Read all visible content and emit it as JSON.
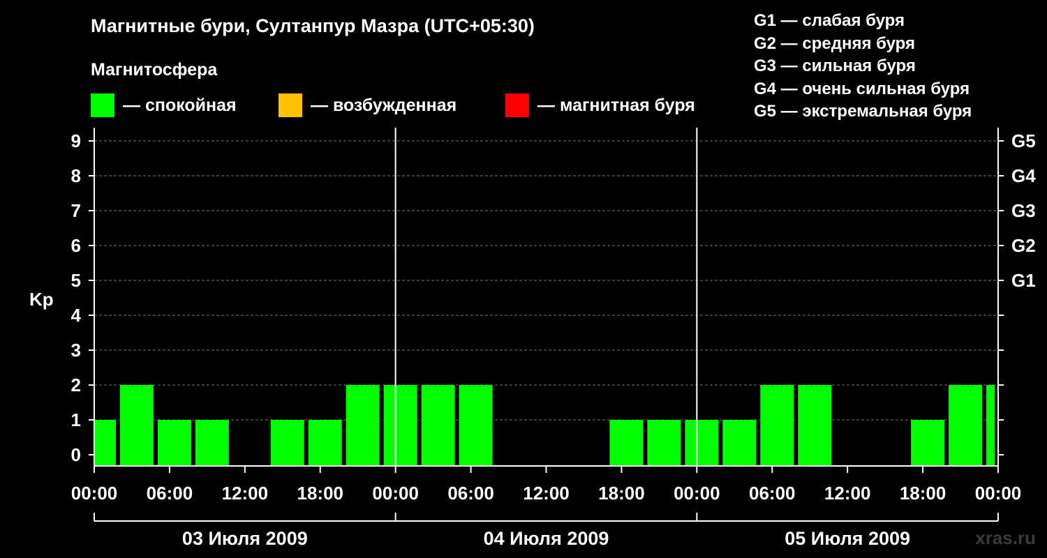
{
  "title": "Магнитные бури, Султанпур Мазра (UTC+05:30)",
  "subtitle": "Магнитосфера",
  "legend": [
    {
      "label": "— спокойная",
      "color": "#00ff00"
    },
    {
      "label": "— возбужденная",
      "color": "#ffc000"
    },
    {
      "label": "— магнитная буря",
      "color": "#ff0000"
    }
  ],
  "g_scale": [
    "G1 — слабая буря",
    "G2 — средняя буря",
    "G3 — сильная буря",
    "G4 — очень сильная буря",
    "G5 — экстремальная буря"
  ],
  "watermark": "xras.ru",
  "chart_data": {
    "type": "bar",
    "ylabel": "Kp",
    "ylim": [
      0,
      9
    ],
    "yticks": [
      "0",
      "1",
      "2",
      "3",
      "4",
      "5",
      "6",
      "7",
      "8",
      "9"
    ],
    "y2ticks": [
      {
        "value": 5,
        "label": "G1"
      },
      {
        "value": 6,
        "label": "G2"
      },
      {
        "value": 7,
        "label": "G3"
      },
      {
        "value": 8,
        "label": "G4"
      },
      {
        "value": 9,
        "label": "G5"
      }
    ],
    "xticks": [
      "00:00",
      "06:00",
      "12:00",
      "18:00",
      "00:00",
      "06:00",
      "12:00",
      "18:00",
      "00:00",
      "06:00",
      "12:00",
      "18:00",
      "00:00"
    ],
    "days": [
      "03 Июля 2009",
      "04 Июля 2009",
      "05 Июля 2009"
    ],
    "grid": true,
    "series": [
      {
        "values": [
          {
            "start": "2009-07-03 00:00",
            "end": "2009-07-03 02:00",
            "kp": 1,
            "status": "спокойная"
          },
          {
            "start": "2009-07-03 02:00",
            "end": "2009-07-03 05:00",
            "kp": 2,
            "status": "спокойная"
          },
          {
            "start": "2009-07-03 05:00",
            "end": "2009-07-03 08:00",
            "kp": 1,
            "status": "спокойная"
          },
          {
            "start": "2009-07-03 08:00",
            "end": "2009-07-03 11:00",
            "kp": 1,
            "status": "спокойная"
          },
          {
            "start": "2009-07-03 11:00",
            "end": "2009-07-03 14:00",
            "kp": 0,
            "status": "спокойная"
          },
          {
            "start": "2009-07-03 14:00",
            "end": "2009-07-03 17:00",
            "kp": 1,
            "status": "спокойная"
          },
          {
            "start": "2009-07-03 17:00",
            "end": "2009-07-03 20:00",
            "kp": 1,
            "status": "спокойная"
          },
          {
            "start": "2009-07-03 20:00",
            "end": "2009-07-03 23:00",
            "kp": 2,
            "status": "спокойная"
          },
          {
            "start": "2009-07-03 23:00",
            "end": "2009-07-04 02:00",
            "kp": 2,
            "status": "спокойная"
          },
          {
            "start": "2009-07-04 02:00",
            "end": "2009-07-04 05:00",
            "kp": 2,
            "status": "спокойная"
          },
          {
            "start": "2009-07-04 05:00",
            "end": "2009-07-04 08:00",
            "kp": 2,
            "status": "спокойная"
          },
          {
            "start": "2009-07-04 08:00",
            "end": "2009-07-04 11:00",
            "kp": 0,
            "status": "спокойная"
          },
          {
            "start": "2009-07-04 11:00",
            "end": "2009-07-04 14:00",
            "kp": 0,
            "status": "спокойная"
          },
          {
            "start": "2009-07-04 14:00",
            "end": "2009-07-04 17:00",
            "kp": 0,
            "status": "спокойная"
          },
          {
            "start": "2009-07-04 17:00",
            "end": "2009-07-04 20:00",
            "kp": 1,
            "status": "спокойная"
          },
          {
            "start": "2009-07-04 20:00",
            "end": "2009-07-04 23:00",
            "kp": 1,
            "status": "спокойная"
          },
          {
            "start": "2009-07-04 23:00",
            "end": "2009-07-05 02:00",
            "kp": 1,
            "status": "спокойная"
          },
          {
            "start": "2009-07-05 02:00",
            "end": "2009-07-05 05:00",
            "kp": 1,
            "status": "спокойная"
          },
          {
            "start": "2009-07-05 05:00",
            "end": "2009-07-05 08:00",
            "kp": 2,
            "status": "спокойная"
          },
          {
            "start": "2009-07-05 08:00",
            "end": "2009-07-05 11:00",
            "kp": 2,
            "status": "спокойная"
          },
          {
            "start": "2009-07-05 11:00",
            "end": "2009-07-05 14:00",
            "kp": 0,
            "status": "спокойная"
          },
          {
            "start": "2009-07-05 14:00",
            "end": "2009-07-05 17:00",
            "kp": 0,
            "status": "спокойная"
          },
          {
            "start": "2009-07-05 17:00",
            "end": "2009-07-05 20:00",
            "kp": 1,
            "status": "спокойная"
          },
          {
            "start": "2009-07-05 20:00",
            "end": "2009-07-05 23:00",
            "kp": 2,
            "status": "спокойная"
          },
          {
            "start": "2009-07-05 23:00",
            "end": "2009-07-06 00:00",
            "kp": 2,
            "status": "спокойная"
          }
        ]
      }
    ]
  }
}
